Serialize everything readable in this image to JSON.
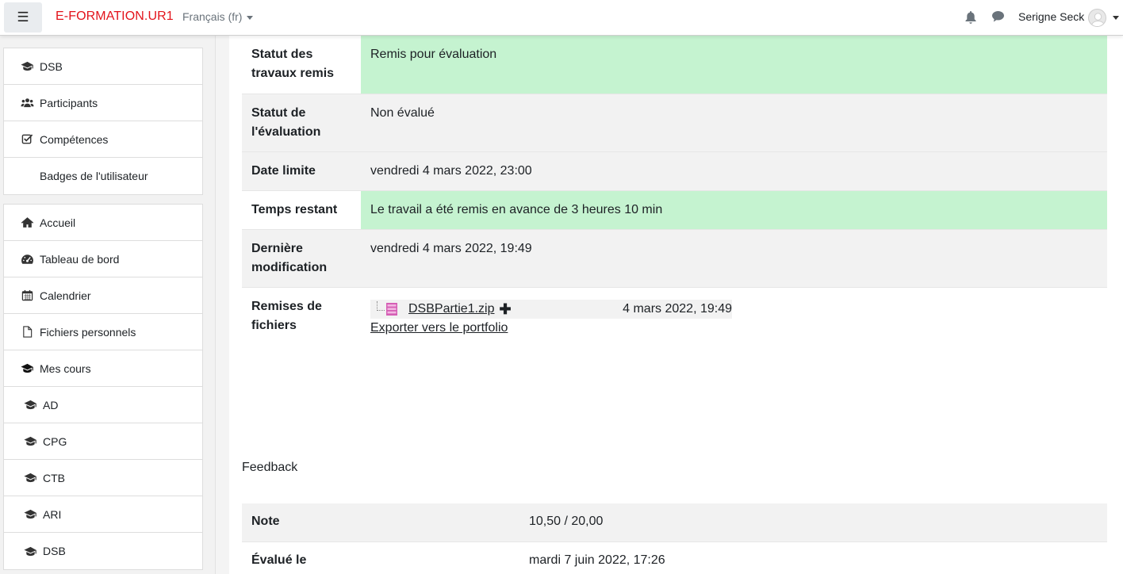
{
  "navbar": {
    "brand": "E-FORMATION.UR1",
    "language": "Français (fr)",
    "username": "Serigne Seck"
  },
  "sidebar": {
    "course_items": [
      {
        "label": "DSB",
        "icon": "graduation-cap-icon"
      },
      {
        "label": "Participants",
        "icon": "users-icon"
      },
      {
        "label": "Compétences",
        "icon": "check-square-icon"
      },
      {
        "label": "Badges de l'utilisateur",
        "icon": ""
      }
    ],
    "site_items": [
      {
        "label": "Accueil",
        "icon": "home-icon"
      },
      {
        "label": "Tableau de bord",
        "icon": "dashboard-icon"
      },
      {
        "label": "Calendrier",
        "icon": "calendar-icon"
      },
      {
        "label": "Fichiers personnels",
        "icon": "file-icon"
      },
      {
        "label": "Mes cours",
        "icon": "graduation-cap-icon"
      },
      {
        "label": "AD",
        "icon": "graduation-cap-icon"
      },
      {
        "label": "CPG",
        "icon": "graduation-cap-icon"
      },
      {
        "label": "CTB",
        "icon": "graduation-cap-icon"
      },
      {
        "label": "ARI",
        "icon": "graduation-cap-icon"
      },
      {
        "label": "DSB",
        "icon": "graduation-cap-icon"
      }
    ]
  },
  "submission_status": {
    "rows": [
      {
        "label": "Statut des travaux remis",
        "value": "Remis pour évaluation"
      },
      {
        "label": "Statut de l'évaluation",
        "value": "Non évalué"
      },
      {
        "label": "Date limite",
        "value": "vendredi 4 mars 2022, 23:00"
      },
      {
        "label": "Temps restant",
        "value": "Le travail a été remis en avance de 3 heures 10 min"
      },
      {
        "label": "Dernière modification",
        "value": "vendredi 4 mars 2022, 19:49"
      },
      {
        "label": "Remises de fichiers",
        "value": ""
      }
    ],
    "file": {
      "name": "DSBPartie1.zip",
      "plus": "✚",
      "date": "4 mars 2022, 19:49",
      "export_label": "Exporter vers le portfolio"
    }
  },
  "feedback": {
    "title": "Feedback",
    "rows": [
      {
        "label": "Note",
        "value": "10,50 / 20,00"
      },
      {
        "label": "Évalué le",
        "value": "mardi 7 juin 2022, 17:26"
      }
    ]
  },
  "colors": {
    "brand": "#e3131b",
    "success_bg": "#c5f3d0",
    "row_alt_bg": "#f2f2f2"
  }
}
